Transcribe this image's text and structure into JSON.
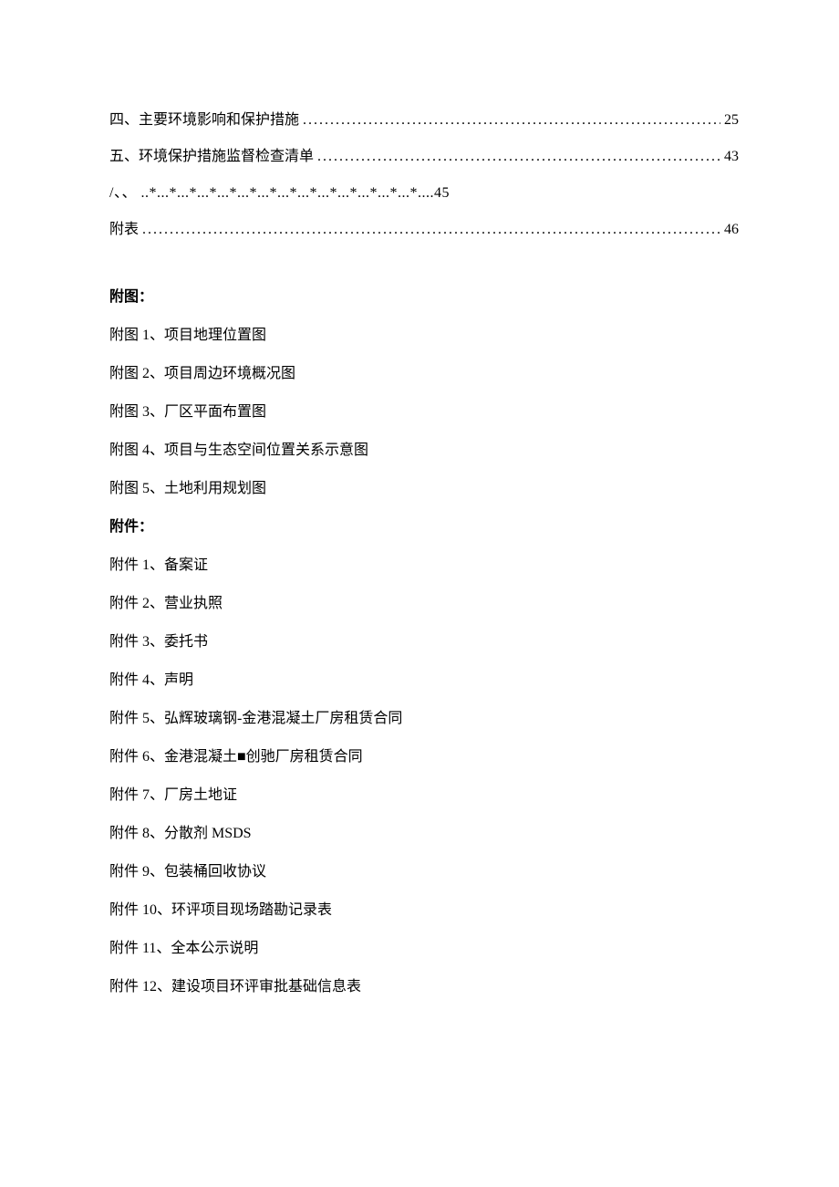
{
  "toc": {
    "entries": [
      {
        "label": "四、主要环境影响和保护措施",
        "page": "25"
      },
      {
        "label": "五、环境保护措施监督检查清单",
        "page": "43"
      }
    ],
    "garbled": {
      "label": "/、、 ..*...*...*...*...*...*...*...*...*...*...*...*...*...*....45"
    },
    "last": {
      "label": "附表",
      "page": "46"
    }
  },
  "figures": {
    "heading": "附图：",
    "items": [
      "附图 1、项目地理位置图",
      "附图 2、项目周边环境概况图",
      "附图 3、厂区平面布置图",
      "附图 4、项目与生态空间位置关系示意图",
      "附图 5、土地利用规划图"
    ]
  },
  "attachments": {
    "heading": "附件：",
    "items": [
      "附件 1、备案证",
      "附件 2、营业执照",
      "附件 3、委托书",
      "附件 4、声明",
      "附件 5、弘辉玻璃钢-金港混凝土厂房租赁合同",
      "附件 6、金港混凝土■创驰厂房租赁合同",
      "附件 7、厂房土地证",
      "附件 8、分散剂 MSDS",
      "附件 9、包装桶回收协议",
      "附件 10、环评项目现场踏勘记录表",
      "附件 11、全本公示说明",
      "附件 12、建设项目环评审批基础信息表"
    ]
  }
}
